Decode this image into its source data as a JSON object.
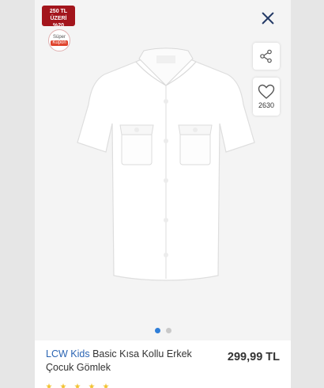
{
  "badges": {
    "promo_line1": "250 TL ÜZERİ",
    "promo_line2": "%20",
    "coupon_line1": "Süper",
    "coupon_line2": "Kupon"
  },
  "actions": {
    "close_icon": "close-icon",
    "share_icon": "share-icon",
    "favorite_icon": "heart-icon",
    "favorite_count": "2630"
  },
  "gallery": {
    "image_subject": "white short-sleeve shirt",
    "pages": 2,
    "active_page": 1
  },
  "product": {
    "brand": "LCW Kids",
    "name": "Basic Kısa Kollu Erkek Çocuk Gömlek",
    "price": "299,99 TL"
  },
  "colors": {
    "brand": "#2a64b3",
    "promo": "#a3151c",
    "close": "#243a66",
    "active_dot": "#2f7ed8",
    "star": "#f2c230"
  }
}
